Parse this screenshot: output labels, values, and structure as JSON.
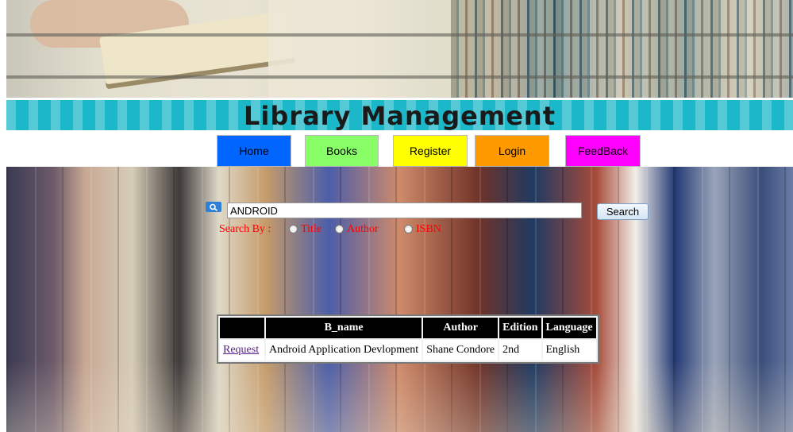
{
  "header": {
    "title": "Library Management"
  },
  "nav": [
    {
      "label": "Home",
      "color": "#0066ff"
    },
    {
      "label": "Books",
      "color": "#88ff66"
    },
    {
      "label": "Register",
      "color": "#ffff00"
    },
    {
      "label": "Login",
      "color": "#ff9900"
    },
    {
      "label": "FeedBack",
      "color": "#ff00ff"
    }
  ],
  "search": {
    "value": "ANDROID",
    "button_label": "Search",
    "search_by_label": "Search By :",
    "options": [
      "Title",
      "Author",
      "ISBN"
    ]
  },
  "results": {
    "columns": [
      "",
      "B_name",
      "Author",
      "Edition",
      "Language"
    ],
    "rows": [
      {
        "action": "Request",
        "b_name": "Android Application Devlopment",
        "author": "Shane Condore",
        "edition": "2nd",
        "language": "English"
      }
    ]
  }
}
